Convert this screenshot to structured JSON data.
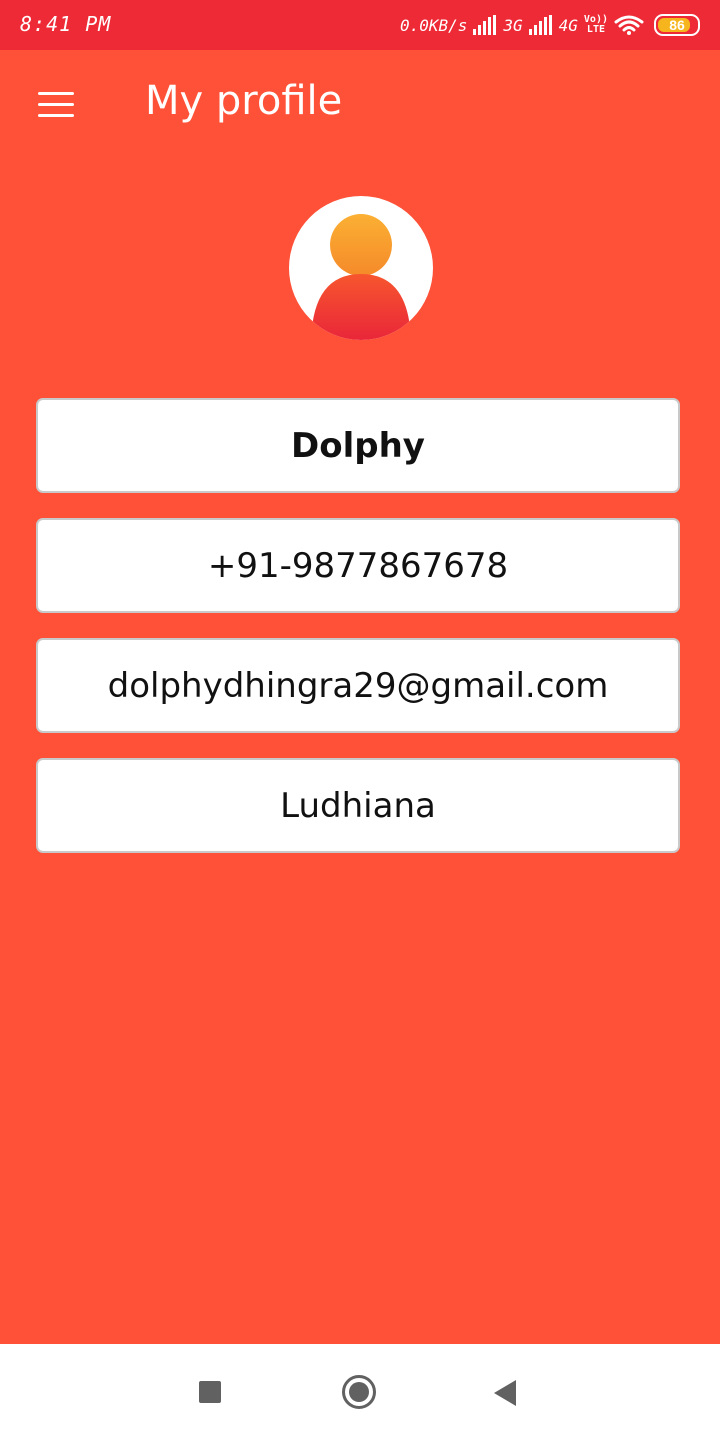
{
  "status_bar": {
    "time": "8:41 PM",
    "network_speed": "0.0KB/s",
    "net1_label": "3G",
    "net2_label": "4G",
    "volte_line1": "Vo))",
    "volte_line2": "LTE",
    "battery_level": "86",
    "battery_fraction": 0.86
  },
  "app_bar": {
    "title": "My profile",
    "menu_icon": "hamburger-menu-icon"
  },
  "avatar": {
    "icon": "person-avatar-icon",
    "head_color": "#f8a432",
    "body_color": "#ee2a36"
  },
  "profile": {
    "name": "Dolphy",
    "phone": "+91-9877867678",
    "email": "dolphydhingra29@gmail.com",
    "city": "Ludhiana"
  },
  "nav_bar": {
    "recents_icon": "square-recents-icon",
    "home_icon": "circle-home-icon",
    "back_icon": "triangle-back-icon"
  },
  "colors": {
    "status_bar": "#ee2a36",
    "background": "#ff5138",
    "card": "#ffffff",
    "nav_bar": "#ffffff"
  }
}
